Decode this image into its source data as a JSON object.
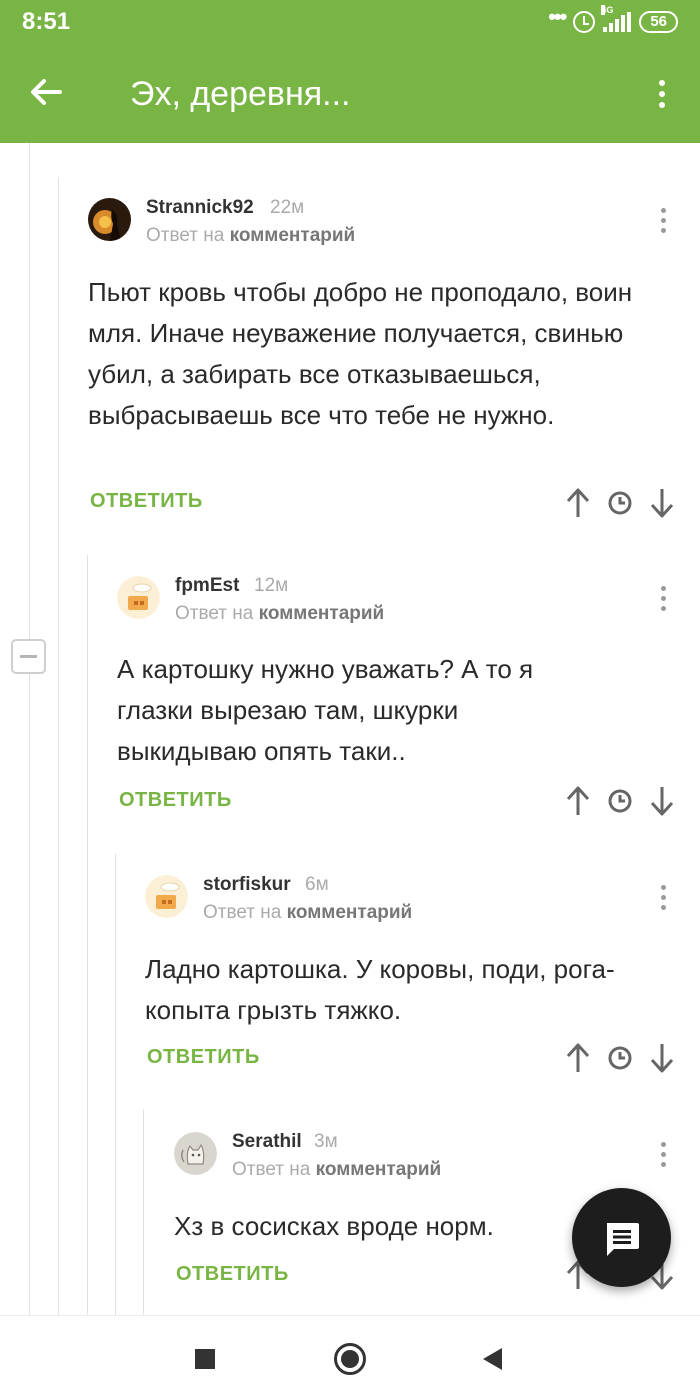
{
  "status_bar": {
    "time": "8:51",
    "network": "4G",
    "battery": "56"
  },
  "header": {
    "title": "Эх, деревня..."
  },
  "comments": [
    {
      "author": "Strannick92",
      "ago": "22м",
      "reply_prefix": "Ответ на",
      "reply_target": "комментарий",
      "text": "Пьют кровь чтобы добро не проподало, воин мля. Иначе неуважение получается, свинью убил, а забирать все отказываешься, выбрасываешь все что тебе не нужно.",
      "reply_label": "ОТВЕТИТЬ"
    },
    {
      "author": "fpmEst",
      "ago": "12м",
      "reply_prefix": "Ответ на",
      "reply_target": "комментарий",
      "text": "А картошку нужно уважать? А то я глазки вырезаю там, шкурки выкидываю опять таки..",
      "reply_label": "ОТВЕТИТЬ"
    },
    {
      "author": "storfiskur",
      "ago": "6м",
      "reply_prefix": "Ответ на",
      "reply_target": "комментарий",
      "text": "Ладно картошка. У коровы, поди, рога-копыта грызть тяжко.",
      "reply_label": "ОТВЕТИТЬ"
    },
    {
      "author": "Serathil",
      "ago": "3м",
      "reply_prefix": "Ответ на",
      "reply_target": "комментарий",
      "text": "Хз в сосисках вроде норм.",
      "reply_label": "ОТВЕТИТЬ"
    }
  ],
  "icons": {
    "back": "arrow-left-icon",
    "menu": "more-vertical-icon",
    "upvote": "arrow-up-icon",
    "save": "clock-icon",
    "downvote": "arrow-down-icon",
    "fab": "comment-icon"
  },
  "colors": {
    "accent": "#79b544",
    "fab": "#1d1d1d"
  }
}
